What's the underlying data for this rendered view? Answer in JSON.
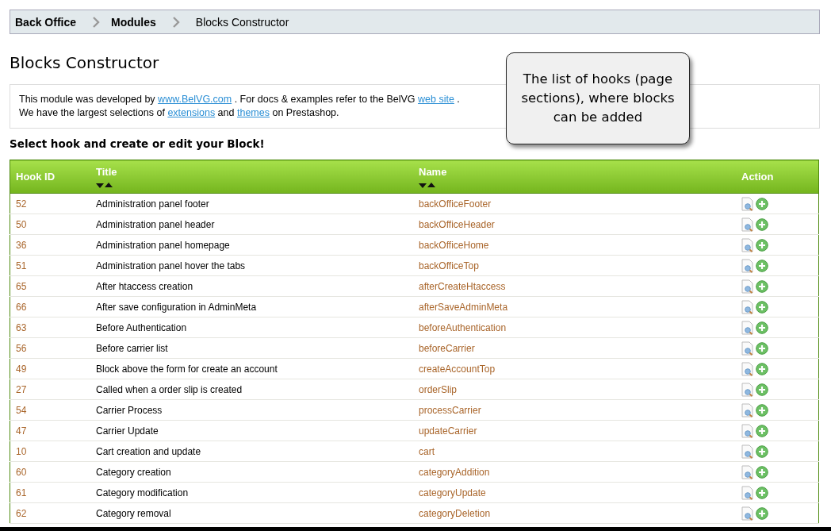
{
  "breadcrumb": [
    {
      "label": "Back Office",
      "kind": "link"
    },
    {
      "label": "Modules",
      "kind": "link"
    },
    {
      "label": "Blocks Constructor",
      "kind": "current"
    }
  ],
  "title": "Blocks Constructor",
  "info": {
    "line_1": [
      "This module was developed by ",
      "www.BelVG.com",
      " . For docs & examples refer to the BelVG ",
      "web site",
      " ."
    ],
    "line_2": [
      "We have the largest selections of ",
      "extensions",
      " and ",
      "themes",
      " on Prestashop."
    ]
  },
  "callout": "The list of hooks (page sections), where blocks can be added",
  "subtitle": "Select hook and create or edit your Block!",
  "table": {
    "columns": [
      {
        "label": "Hook ID",
        "sortable": false
      },
      {
        "label": "Title",
        "sortable": true
      },
      {
        "label": "Name",
        "sortable": true
      },
      {
        "label": "Action",
        "sortable": false
      }
    ],
    "rows": [
      {
        "id": "52",
        "title": "Administration panel footer",
        "name": "backOfficeFooter"
      },
      {
        "id": "50",
        "title": "Administration panel header",
        "name": "backOfficeHeader"
      },
      {
        "id": "36",
        "title": "Administration panel homepage",
        "name": "backOfficeHome"
      },
      {
        "id": "51",
        "title": "Administration panel hover the tabs",
        "name": "backOfficeTop"
      },
      {
        "id": "65",
        "title": "After htaccess creation",
        "name": "afterCreateHtaccess"
      },
      {
        "id": "66",
        "title": "After save configuration in AdminMeta",
        "name": "afterSaveAdminMeta"
      },
      {
        "id": "63",
        "title": "Before Authentication",
        "name": "beforeAuthentication"
      },
      {
        "id": "56",
        "title": "Before carrier list",
        "name": "beforeCarrier"
      },
      {
        "id": "49",
        "title": "Block above the form for create an account",
        "name": "createAccountTop"
      },
      {
        "id": "27",
        "title": "Called when a order slip is created",
        "name": "orderSlip"
      },
      {
        "id": "54",
        "title": "Carrier Process",
        "name": "processCarrier"
      },
      {
        "id": "47",
        "title": "Carrier Update",
        "name": "updateCarrier"
      },
      {
        "id": "10",
        "title": "Cart creation and update",
        "name": "cart"
      },
      {
        "id": "60",
        "title": "Category creation",
        "name": "categoryAddition"
      },
      {
        "id": "61",
        "title": "Category modification",
        "name": "categoryUpdate"
      },
      {
        "id": "62",
        "title": "Category removal",
        "name": "categoryDeletion"
      }
    ]
  }
}
